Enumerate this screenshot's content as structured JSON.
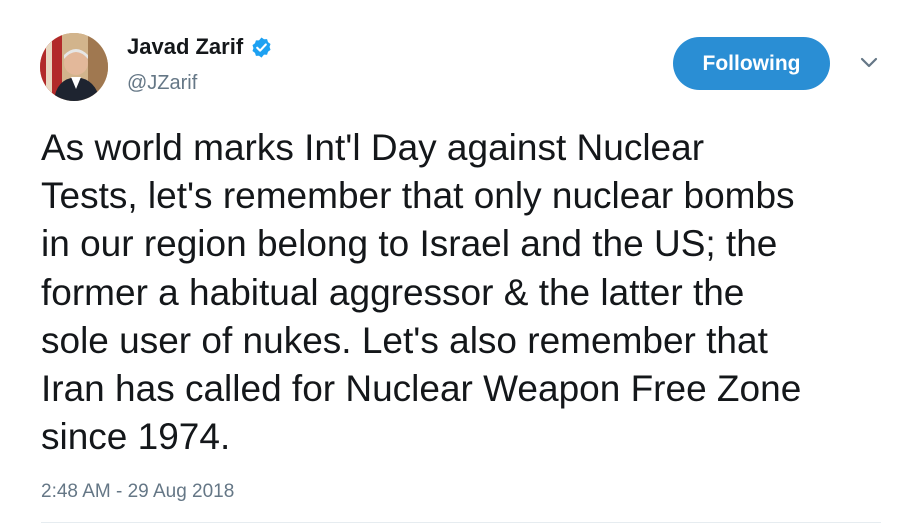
{
  "tweet": {
    "author": {
      "display_name": "Javad Zarif",
      "handle": "@JZarif",
      "avatar_icon": "profile-photo",
      "verified_icon": "verified-badge-icon",
      "verified_color": "#1da1f2"
    },
    "follow_button": {
      "label": "Following",
      "color": "#2a8ed4"
    },
    "menu_icon": "chevron-down-icon",
    "text_lines": [
      "As world marks Int'l Day against Nuclear",
      "Tests, let's remember that only nuclear bombs",
      "in our region belong to Israel and the US; the",
      "former a habitual aggressor & the latter the",
      "sole user of nukes. Let's also remember that",
      "Iran has called for Nuclear Weapon Free Zone",
      "since 1974."
    ],
    "timestamp": "2:48 AM - 29 Aug 2018"
  }
}
